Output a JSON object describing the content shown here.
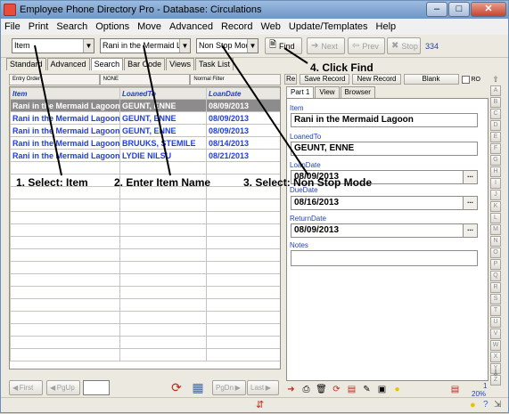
{
  "window": {
    "title": "Employee Phone Directory Pro - Database: Circulations"
  },
  "menu": [
    "File",
    "Print",
    "Search",
    "Options",
    "Move",
    "Advanced",
    "Record",
    "Web",
    "Update/Templates",
    "Help"
  ],
  "toolbar": {
    "field_select": "Item",
    "search_value": "Rani in the Mermaid Lagoon",
    "mode_select": "Non Stop Mode",
    "find_label": "Find",
    "next_label": "Next",
    "prev_label": "Prev",
    "stop_label": "Stop",
    "record_count": "334"
  },
  "tabs": [
    "Standard",
    "Advanced",
    "Search",
    "Bar Code",
    "Views",
    "Task List"
  ],
  "filterbar": [
    "Entry Order",
    "NONE",
    "Normal Filter"
  ],
  "grid": {
    "columns": [
      "Item",
      "LoanedTo",
      "LoanDate"
    ],
    "rows": [
      [
        "Rani in the Mermaid Lagoon",
        "GEUNT, ENNE",
        "08/09/2013"
      ],
      [
        "Rani in the Mermaid Lagoon",
        "GEUNT, ENNE",
        "08/09/2013"
      ],
      [
        "Rani in the Mermaid Lagoon",
        "GEUNT, ENNE",
        "08/09/2013"
      ],
      [
        "Rani in the Mermaid Lagoon",
        "BRUUKS, STEMILE",
        "08/14/2013"
      ],
      [
        "Rani in the Mermaid Lagoon",
        "LYDIE NILSU",
        "08/21/2013"
      ]
    ]
  },
  "bottombar": {
    "first": "First",
    "pgup": "PgUp",
    "pgdn": "PgDn",
    "last": "Last"
  },
  "record_panel": {
    "buttons": [
      "Re",
      "Save Record",
      "New Record",
      "Blank"
    ],
    "ro_label": "RO",
    "tabs": [
      "Part 1",
      "View",
      "Browser"
    ],
    "fields": [
      {
        "label": "Item",
        "value": "Rani in the Mermaid Lagoon"
      },
      {
        "label": "LoanedTo",
        "value": "GEUNT, ENNE"
      },
      {
        "label": "LoanDate",
        "value": "08/09/2013"
      },
      {
        "label": "DueDate",
        "value": "08/16/2013"
      },
      {
        "label": "ReturnDate",
        "value": "08/09/2013"
      },
      {
        "label": "Notes",
        "value": ""
      }
    ],
    "page": "1",
    "zoom": "20%"
  },
  "alphabet": [
    "A",
    "B",
    "C",
    "D",
    "E",
    "F",
    "G",
    "H",
    "I",
    "J",
    "K",
    "L",
    "M",
    "N",
    "O",
    "P",
    "Q",
    "R",
    "S",
    "T",
    "U",
    "V",
    "W",
    "X",
    "Y",
    "Z"
  ],
  "annotations": {
    "step1": "1. Select: Item",
    "step2": "2. Enter Item Name",
    "step3": "3. Select: Non Stop Mode",
    "step4": "4. Click Find"
  },
  "colors": {
    "title_bg": "#6f96c6",
    "link_blue": "#1f3fdc",
    "selected_row": "#8c8c8c"
  }
}
